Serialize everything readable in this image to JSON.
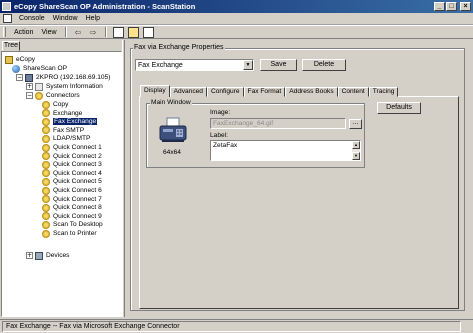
{
  "window": {
    "title": "eCopy ShareScan OP Administration - ScanStation",
    "buttons": [
      "_",
      "□",
      "×"
    ]
  },
  "menu": {
    "items": [
      "Console",
      "Window",
      "Help"
    ]
  },
  "toolbar": {
    "action": "Action",
    "view": "View",
    "back": "⇦",
    "forward": "⇨"
  },
  "tree": {
    "tab_label": "Tree",
    "root": "eCopy",
    "sharescan": "ShareScan OP",
    "server": "2KPRO (192.168.69.105)",
    "system_info": "System Information",
    "connectors": "Connectors",
    "connector_items": [
      "Copy",
      "Exchange",
      "Fax Exchange",
      "Fax SMTP",
      "LDAP/SMTP",
      "Quick Connect 1",
      "Quick Connect 2",
      "Quick Connect 3",
      "Quick Connect 4",
      "Quick Connect 5",
      "Quick Connect 6",
      "Quick Connect 7",
      "Quick Connect 8",
      "Quick Connect 9",
      "Scan To Desktop",
      "Scan to Printer"
    ],
    "selected_index": 2,
    "devices": "Devices",
    "expand_glyph": "+",
    "collapse_glyph": "−"
  },
  "properties": {
    "group_title": "Fax via Exchange Properties",
    "profile_value": "Fax Exchange",
    "save_label": "Save",
    "delete_label": "Delete",
    "tabs": [
      "Display",
      "Advanced",
      "Configure",
      "Fax Format",
      "Address Books",
      "Content",
      "Tracing"
    ],
    "active_tab": "Display",
    "main_window_title": "Main Window",
    "icon_size_label": "64x64",
    "image_label": "Image:",
    "image_value": "FaxExchange_64.gif",
    "browse_label": "...",
    "label_label": "Label:",
    "label_value": "ZetaFax",
    "defaults_label": "Defaults"
  },
  "status": {
    "text": "Fax Exchange -- Fax via Microsoft Exchange Connector"
  },
  "colors": {
    "titlebar_start": "#0a246a",
    "titlebar_end": "#3a6ea5",
    "selection": "#0a246a",
    "face": "#d4d0c8"
  }
}
